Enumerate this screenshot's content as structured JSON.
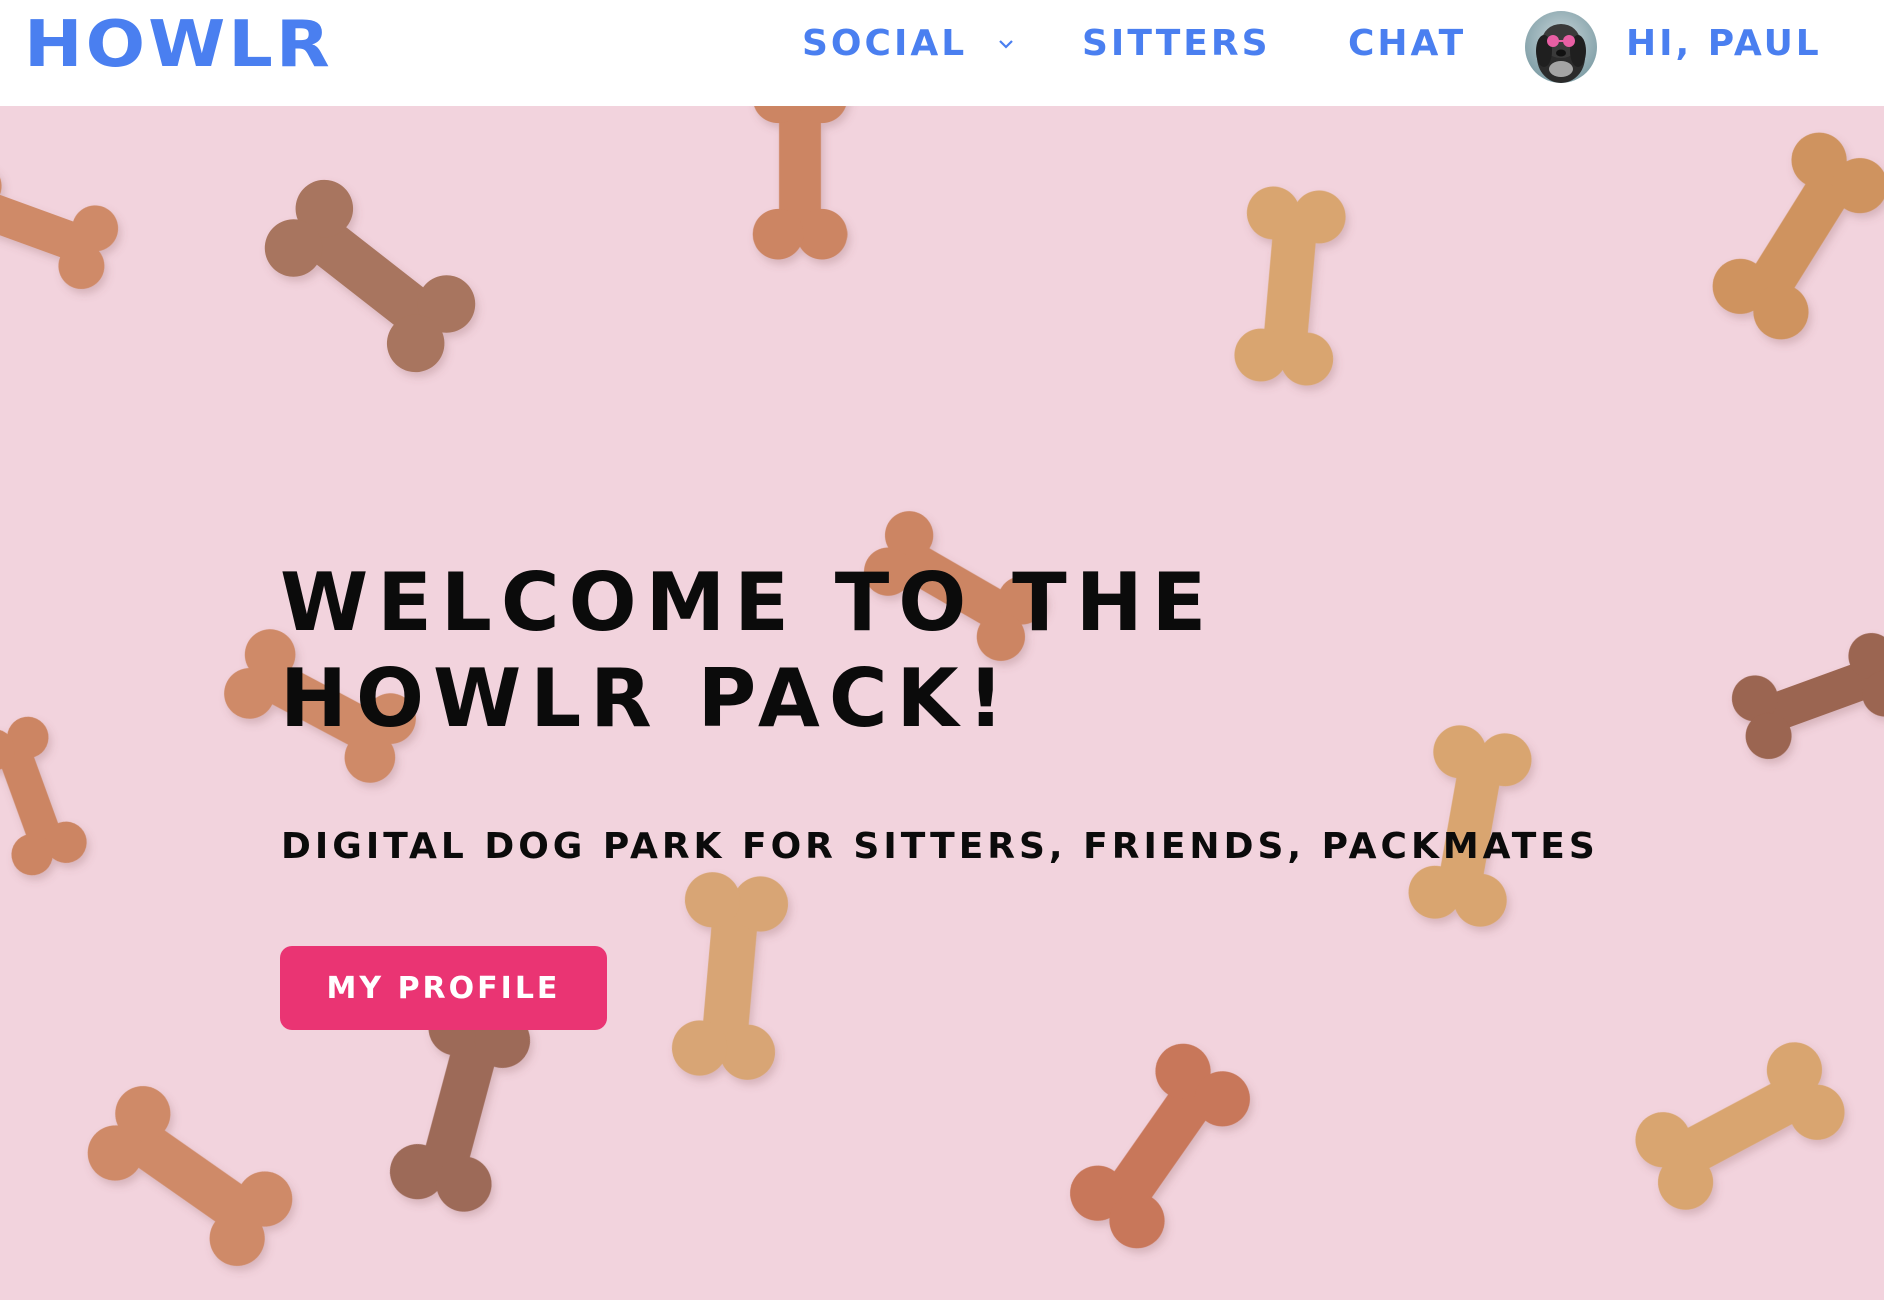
{
  "nav": {
    "logo": "HOWLR",
    "items": [
      {
        "label": "SOCIAL",
        "has_dropdown": true
      },
      {
        "label": "SITTERS"
      },
      {
        "label": "CHAT"
      }
    ],
    "greeting": "HI, PAUL",
    "avatar_icon": "avatar-dog-icon",
    "dropdown_icon": "chevron-down-icon"
  },
  "hero": {
    "headline_line1": "WELCOME TO THE",
    "headline_line2": "HOWLR PACK!",
    "subheading": "DIGITAL DOG PARK FOR SITTERS, FRIENDS, PACKMATES",
    "cta_label": "MY PROFILE",
    "background_image": "dog-biscuit-bones-pattern"
  },
  "colors": {
    "brand_blue": "#4a7ff0",
    "cta_pink": "#ea3473",
    "hero_bg": "#f2d3dd",
    "text_dark": "#0b0b0b"
  }
}
